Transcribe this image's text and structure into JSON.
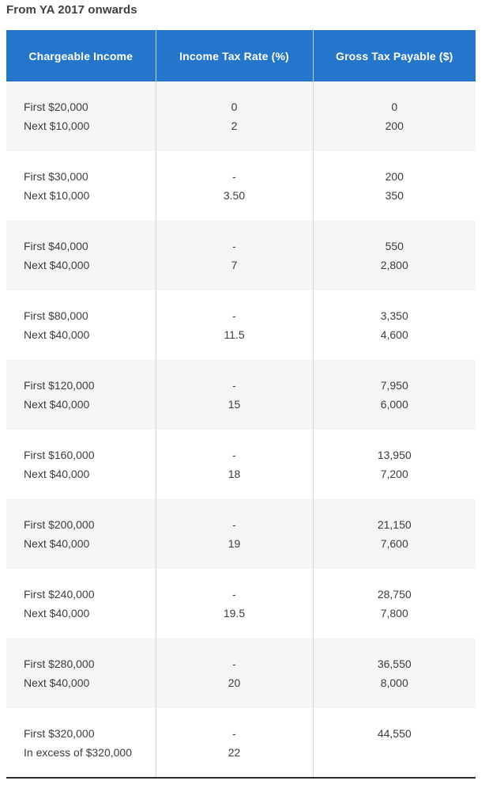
{
  "section": {
    "title": "From YA 2017 onwards"
  },
  "colors": {
    "header_background": "#2576ca",
    "header_text": "#ffffff",
    "row_alt_background": "#f5f5f5",
    "row_background": "#ffffff",
    "body_text": "#3c3c3c",
    "title_text": "#404040",
    "divider": "#d6d6d6",
    "table_bottom_border": "#2b2b2b"
  },
  "table": {
    "columns": [
      {
        "key": "chargeable_income",
        "label": "Chargeable Income"
      },
      {
        "key": "income_tax_rate",
        "label": "Income Tax Rate (%)"
      },
      {
        "key": "gross_tax_payable",
        "label": "Gross Tax Payable ($)"
      }
    ],
    "rows": [
      {
        "income_line1": "First $20,000",
        "income_line2": "Next $10,000",
        "rate_line1": "0",
        "rate_line2": "2",
        "gross_line1": "0",
        "gross_line2": "200"
      },
      {
        "income_line1": "First $30,000",
        "income_line2": "Next $10,000",
        "rate_line1": "-",
        "rate_line2": "3.50",
        "gross_line1": "200",
        "gross_line2": "350"
      },
      {
        "income_line1": "First $40,000",
        "income_line2": "Next $40,000",
        "rate_line1": "-",
        "rate_line2": "7",
        "gross_line1": "550",
        "gross_line2": "2,800"
      },
      {
        "income_line1": "First $80,000",
        "income_line2": "Next $40,000",
        "rate_line1": "-",
        "rate_line2": "11.5",
        "gross_line1": "3,350",
        "gross_line2": "4,600"
      },
      {
        "income_line1": "First $120,000",
        "income_line2": "Next $40,000",
        "rate_line1": "-",
        "rate_line2": "15",
        "gross_line1": "7,950",
        "gross_line2": "6,000"
      },
      {
        "income_line1": "First $160,000",
        "income_line2": "Next $40,000",
        "rate_line1": "-",
        "rate_line2": "18",
        "gross_line1": "13,950",
        "gross_line2": "7,200"
      },
      {
        "income_line1": "First $200,000",
        "income_line2": "Next $40,000",
        "rate_line1": "-",
        "rate_line2": "19",
        "gross_line1": "21,150",
        "gross_line2": "7,600"
      },
      {
        "income_line1": "First $240,000",
        "income_line2": "Next $40,000",
        "rate_line1": "-",
        "rate_line2": "19.5",
        "gross_line1": "28,750",
        "gross_line2": "7,800"
      },
      {
        "income_line1": "First $280,000",
        "income_line2": "Next $40,000",
        "rate_line1": "-",
        "rate_line2": "20",
        "gross_line1": "36,550",
        "gross_line2": "8,000"
      },
      {
        "income_line1": "First $320,000",
        "income_line2": "In excess of $320,000",
        "rate_line1": "-",
        "rate_line2": "22",
        "gross_line1": "44,550",
        "gross_line2": ""
      }
    ]
  }
}
